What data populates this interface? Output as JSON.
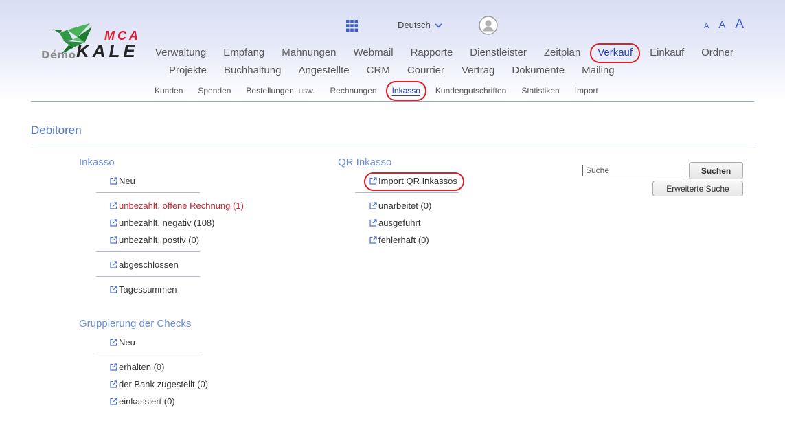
{
  "header": {
    "logo": {
      "mca": "MCA",
      "kale": "KALE",
      "demo": "Démo"
    },
    "language": "Deutsch",
    "font_size_controls": [
      "A",
      "A",
      "A"
    ]
  },
  "icons": {
    "apps": "grid-icon",
    "language_dropdown": "chevron-down-icon",
    "account": "user-avatar-icon",
    "link": "external-link-icon"
  },
  "main_nav": {
    "row1": [
      {
        "label": "Verwaltung"
      },
      {
        "label": "Empfang"
      },
      {
        "label": "Mahnungen"
      },
      {
        "label": "Webmail"
      },
      {
        "label": "Rapporte"
      },
      {
        "label": "Dienstleister"
      },
      {
        "label": "Zeitplan"
      },
      {
        "label": "Verkauf",
        "active": true,
        "annotated": true
      },
      {
        "label": "Einkauf"
      },
      {
        "label": "Ordner"
      }
    ],
    "row2": [
      {
        "label": "Projekte"
      },
      {
        "label": "Buchhaltung"
      },
      {
        "label": "Angestellte"
      },
      {
        "label": "CRM"
      },
      {
        "label": "Courrier"
      },
      {
        "label": "Vertrag"
      },
      {
        "label": "Dokumente"
      },
      {
        "label": "Mailing"
      }
    ]
  },
  "sub_nav": {
    "items": [
      {
        "label": "Kunden"
      },
      {
        "label": "Spenden"
      },
      {
        "label": "Bestellungen, usw."
      },
      {
        "label": "Rechnungen"
      },
      {
        "label": "Inkasso",
        "active": true,
        "annotated": true
      },
      {
        "label": "Kundengutschriften"
      },
      {
        "label": "Statistiken"
      },
      {
        "label": "Import"
      }
    ]
  },
  "page": {
    "title": "Debitoren"
  },
  "inkasso": {
    "heading": "Inkasso",
    "groups": [
      [
        {
          "label": "Neu"
        }
      ],
      [
        {
          "label": "unbezahlt, offene Rechnung (1)",
          "alert": true
        },
        {
          "label": "unbezahlt, negativ (108)"
        },
        {
          "label": "unbezahlt, postiv (0)"
        }
      ],
      [
        {
          "label": "abgeschlossen"
        }
      ],
      [
        {
          "label": "Tagessummen"
        }
      ]
    ]
  },
  "checks": {
    "heading": "Gruppierung der Checks",
    "groups": [
      [
        {
          "label": "Neu"
        }
      ],
      [
        {
          "label": "erhalten (0)"
        },
        {
          "label": "der Bank zugestellt (0)"
        },
        {
          "label": "einkassiert (0)"
        }
      ]
    ]
  },
  "qr_inkasso": {
    "heading": "QR Inkasso",
    "groups": [
      [
        {
          "label": "Import QR Inkassos",
          "annotated": true
        }
      ],
      [
        {
          "label": "unarbeitet (0)"
        },
        {
          "label": "ausgeführt"
        },
        {
          "label": "fehlerhaft (0)"
        }
      ]
    ]
  },
  "search": {
    "placeholder": "Suche",
    "button": "Suchen",
    "advanced_button": "Erweiterte Suche"
  },
  "colors": {
    "accent": "#3d5ccf",
    "active_nav": "#1f3fae",
    "heading": "#6d8fd6",
    "title": "#5577c0",
    "alert_text": "#d0202e",
    "annotation_ring": "#d8232a",
    "logo_red": "#e31b2d",
    "logo_green": "#2f9a45"
  }
}
